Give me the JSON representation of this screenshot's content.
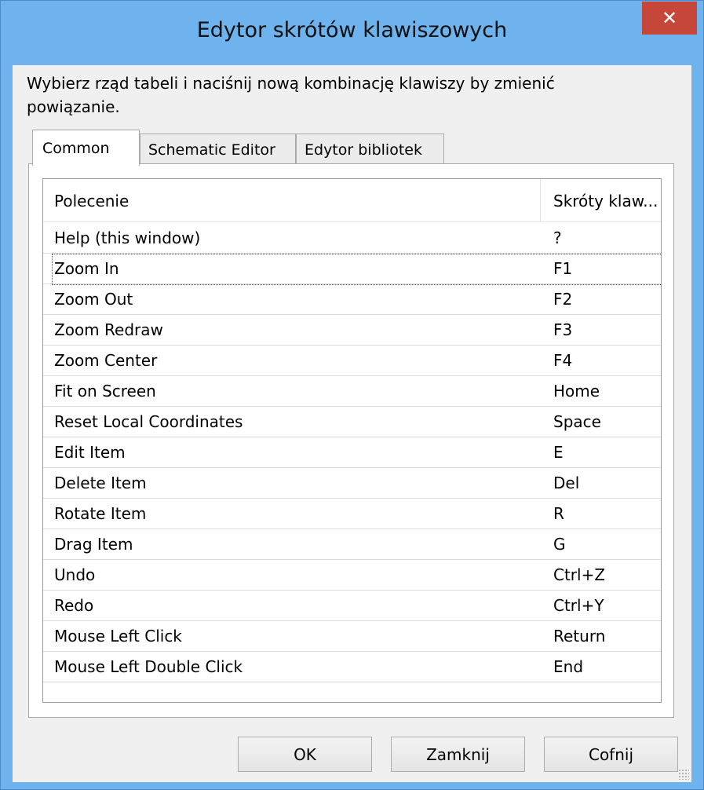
{
  "window": {
    "title": "Edytor skrótów klawiszowych",
    "close_glyph": "✕"
  },
  "instruction": "Wybierz rząd tabeli i naciśnij nową kombinację klawiszy by zmienić powiązanie.",
  "tabs": [
    {
      "label": "Common",
      "active": true
    },
    {
      "label": "Schematic Editor",
      "active": false
    },
    {
      "label": "Edytor bibliotek",
      "active": false
    }
  ],
  "table": {
    "columns": [
      "Polecenie",
      "Skróty klaw..."
    ],
    "rows": [
      {
        "command": "Help (this window)",
        "shortcut": "?"
      },
      {
        "command": "Zoom In",
        "shortcut": "F1"
      },
      {
        "command": "Zoom Out",
        "shortcut": "F2"
      },
      {
        "command": "Zoom Redraw",
        "shortcut": "F3"
      },
      {
        "command": "Zoom Center",
        "shortcut": "F4"
      },
      {
        "command": "Fit on Screen",
        "shortcut": "Home"
      },
      {
        "command": "Reset Local Coordinates",
        "shortcut": "Space"
      },
      {
        "command": "Edit Item",
        "shortcut": "E"
      },
      {
        "command": "Delete Item",
        "shortcut": "Del"
      },
      {
        "command": "Rotate Item",
        "shortcut": "R"
      },
      {
        "command": "Drag Item",
        "shortcut": "G"
      },
      {
        "command": "Undo",
        "shortcut": "Ctrl+Z"
      },
      {
        "command": "Redo",
        "shortcut": "Ctrl+Y"
      },
      {
        "command": "Mouse Left Click",
        "shortcut": "Return"
      },
      {
        "command": "Mouse Left Double Click",
        "shortcut": "End"
      }
    ],
    "focused_row": 1
  },
  "buttons": {
    "ok": "OK",
    "close": "Zamknij",
    "undo": "Cofnij"
  },
  "colors": {
    "titlebar": "#6eb3ee",
    "close_button": "#c7463a",
    "client": "#f0f0f0"
  }
}
